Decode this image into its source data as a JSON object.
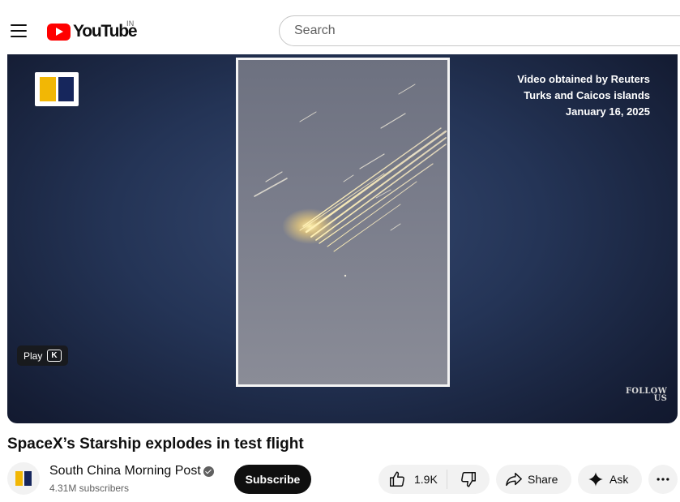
{
  "masthead": {
    "menu_icon": "hamburger-menu-icon",
    "logo_text": "YouTube",
    "country_code": "IN",
    "search_placeholder": "Search"
  },
  "player": {
    "overlay_lines": [
      "Video obtained by Reuters",
      "Turks and Caicos islands",
      "January 16, 2025"
    ],
    "follow_mark": [
      "FOLLOW",
      "US"
    ],
    "play_label": "Play",
    "play_shortcut": "K",
    "colors": {
      "brand_yellow": "#f2b705",
      "brand_navy": "#16265c"
    }
  },
  "video": {
    "title": "SpaceX’s Starship explodes in test flight"
  },
  "owner": {
    "name": "South China Morning Post",
    "subscribers": "4.31M subscribers",
    "verified_icon": "verified-check-icon",
    "subscribe_label": "Subscribe"
  },
  "actions": {
    "like_count": "1.9K",
    "like_icon": "thumbs-up-icon",
    "dislike_icon": "thumbs-down-icon",
    "share_label": "Share",
    "share_icon": "share-arrow-icon",
    "ask_label": "Ask",
    "ask_icon": "sparkle-icon",
    "more_icon": "more-horizontal-icon"
  }
}
